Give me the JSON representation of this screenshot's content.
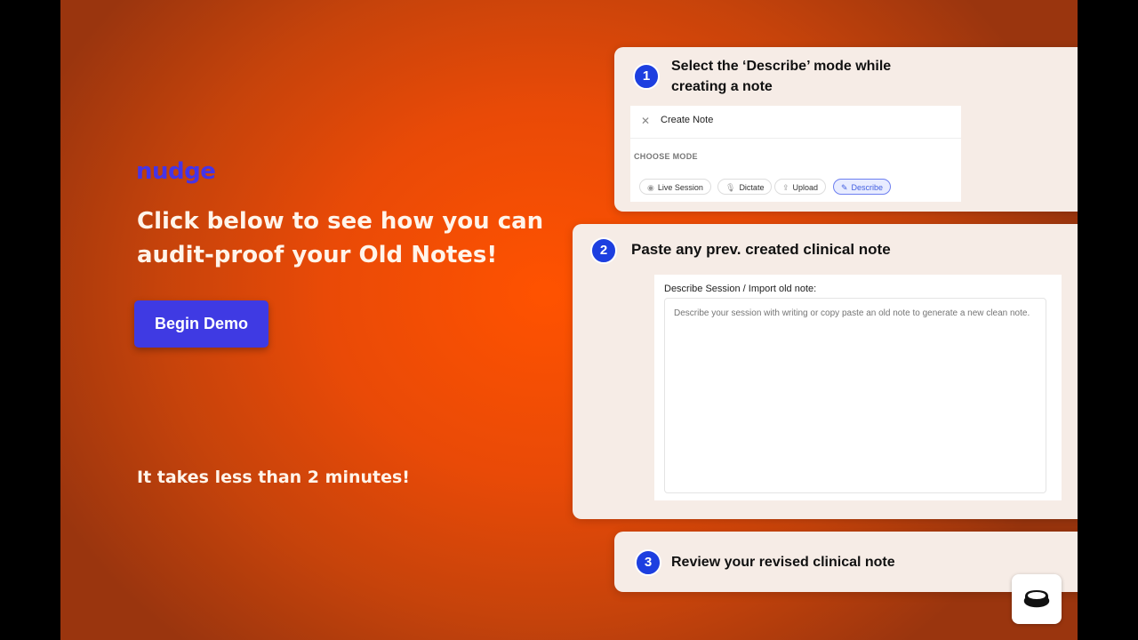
{
  "hero": {
    "logo": "nudge",
    "headline": "Click below to see how you can audit-proof your Old Notes!",
    "begin_button": "Begin Demo",
    "subline": "It takes less than 2 minutes!"
  },
  "steps": [
    {
      "number": "1",
      "text": "Select the ‘Describe’ mode while creating a note",
      "preview": {
        "title": "Create Note",
        "close_glyph": "✕",
        "mode_label": "CHOOSE MODE",
        "modes": [
          "Live Session",
          "Dictate",
          "Upload",
          "Describe"
        ],
        "active_mode": "Describe"
      }
    },
    {
      "number": "2",
      "text": "Paste any prev. created clinical note",
      "preview": {
        "field_label": "Describe Session / Import old note:",
        "placeholder": "Describe your session with writing or copy paste an old note to generate a new clean note."
      }
    },
    {
      "number": "3",
      "text": "Review your revised clinical note"
    }
  ],
  "widget": {
    "icon": "record-icon"
  },
  "colors": {
    "brand": "#4634e6",
    "button": "#3f3ae3",
    "step_badge": "#1d3fe0",
    "card_bg": "#f6ece6",
    "active_chip": "#4460e0"
  }
}
